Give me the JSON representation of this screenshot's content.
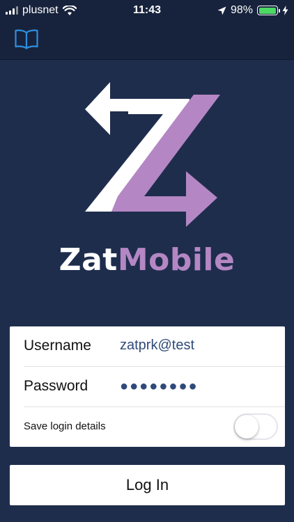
{
  "status_bar": {
    "carrier": "plusnet",
    "time": "11:43",
    "battery_percent_label": "98%",
    "battery_level": 0.98,
    "icons": [
      "signal-icon",
      "wifi-icon",
      "location-arrow-icon",
      "battery-icon",
      "charging-bolt-icon"
    ]
  },
  "nav": {
    "book_icon": "book-icon"
  },
  "brand": {
    "part1": "Zat",
    "part2": "Mobile",
    "colors": {
      "white": "#ffffff",
      "accent": "#b487c4",
      "background": "#1f2d4d"
    }
  },
  "form": {
    "username_label": "Username",
    "username_value": "zatprk@test",
    "password_label": "Password",
    "password_mask": "●●●●●●●●",
    "save_label": "Save login details",
    "save_enabled": false
  },
  "login_button": "Log In"
}
